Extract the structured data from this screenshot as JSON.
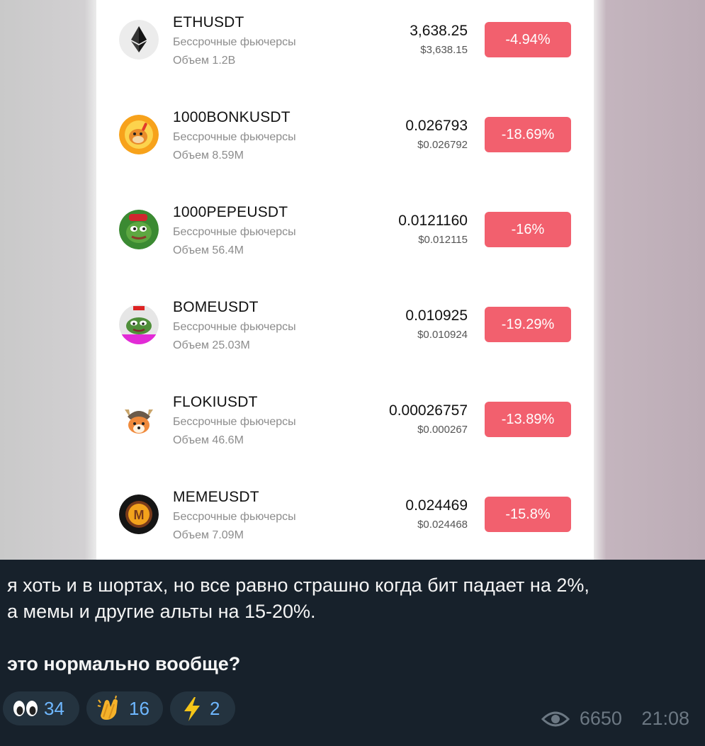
{
  "tickers": [
    {
      "symbol": "ETHUSDT",
      "type": "Бессрочные фьючерсы",
      "volume": "Объем 1.2B",
      "price": "3,638.25",
      "usd_price": "$3,638.15",
      "change": "-4.94%",
      "icon": "ethereum-icon"
    },
    {
      "symbol": "1000BONKUSDT",
      "type": "Бессрочные фьючерсы",
      "volume": "Объем 8.59M",
      "price": "0.026793",
      "usd_price": "$0.026792",
      "change": "-18.69%",
      "icon": "bonk-icon"
    },
    {
      "symbol": "1000PEPEUSDT",
      "type": "Бессрочные фьючерсы",
      "volume": "Объем 56.4M",
      "price": "0.0121160",
      "usd_price": "$0.012115",
      "change": "-16%",
      "icon": "pepe-icon"
    },
    {
      "symbol": "BOMEUSDT",
      "type": "Бессрочные фьючерсы",
      "volume": "Объем 25.03M",
      "price": "0.010925",
      "usd_price": "$0.010924",
      "change": "-19.29%",
      "icon": "bome-icon"
    },
    {
      "symbol": "FLOKIUSDT",
      "type": "Бессрочные фьючерсы",
      "volume": "Объем 46.6M",
      "price": "0.00026757",
      "usd_price": "$0.000267",
      "change": "-13.89%",
      "icon": "floki-icon"
    },
    {
      "symbol": "MEMEUSDT",
      "type": "Бессрочные фьючерсы",
      "volume": "Объем 7.09M",
      "price": "0.024469",
      "usd_price": "$0.024468",
      "change": "-15.8%",
      "icon": "meme-icon"
    }
  ],
  "message": {
    "line1": "я хоть и в шортах, но все равно страшно когда бит падает на 2%,",
    "line2": "а мемы и другие альты на 15-20%.",
    "question": "это нормально вообще?"
  },
  "reactions": [
    {
      "emoji": "eyes",
      "count": "34"
    },
    {
      "emoji": "clapping-hands",
      "count": "16"
    },
    {
      "emoji": "lightning",
      "count": "2"
    }
  ],
  "meta": {
    "views": "6650",
    "time": "21:08"
  },
  "colors": {
    "change_badge": "#f2606e",
    "chat_bg": "#17212b",
    "reaction_count": "#6eb7ff"
  }
}
